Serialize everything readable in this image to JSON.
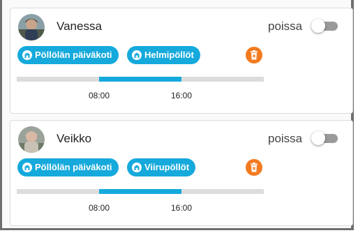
{
  "colors": {
    "chip": "#15a9dc",
    "timeline_active": "#15a9dc",
    "timeline_track": "#dcdcdc",
    "delete": "#f47a1f",
    "toggle_track": "#9a9a9a"
  },
  "children": [
    {
      "name": "Vanessa",
      "absent_label": "poissa",
      "absent_on": false,
      "chips": [
        {
          "label": "Pöllölän päiväkoti",
          "icon": "building-icon"
        },
        {
          "label": "Helmipöllöt",
          "icon": "building-icon"
        }
      ],
      "delete_icon": "trash-icon",
      "timeline": {
        "start_fraction": 0.333,
        "end_fraction": 0.667
      },
      "ticks": [
        "08:00",
        "16:00"
      ]
    },
    {
      "name": "Veikko",
      "absent_label": "poissa",
      "absent_on": false,
      "chips": [
        {
          "label": "Pöllölän päiväkoti",
          "icon": "building-icon"
        },
        {
          "label": "Viirupöllöt",
          "icon": "building-icon"
        }
      ],
      "delete_icon": "trash-icon",
      "timeline": {
        "start_fraction": 0.333,
        "end_fraction": 0.667
      },
      "ticks": [
        "08:00",
        "16:00"
      ]
    }
  ]
}
